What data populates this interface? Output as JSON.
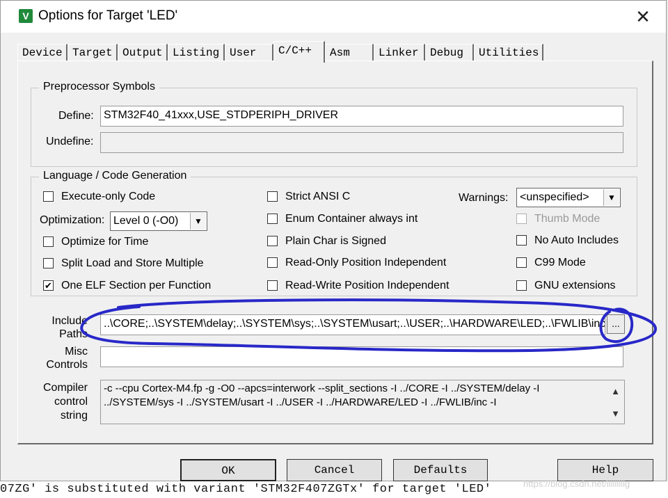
{
  "dialog": {
    "title": "Options for Target 'LED'",
    "close_glyph": "✕",
    "icon_glyph": "V"
  },
  "tabs": [
    "Device",
    "Target",
    "Output",
    "Listing",
    "User",
    "C/C++",
    "Asm",
    "Linker",
    "Debug",
    "Utilities"
  ],
  "active_tab": "C/C++",
  "preprocessor": {
    "group_label": "Preprocessor Symbols",
    "define_label": "Define:",
    "define_value": "STM32F40_41xxx,USE_STDPERIPH_DRIVER",
    "undefine_label": "Undefine:",
    "undefine_value": ""
  },
  "language": {
    "group_label": "Language / Code Generation",
    "execute_only": {
      "label": "Execute-only Code",
      "checked": false
    },
    "optimization": {
      "label": "Optimization:",
      "value": "Level 0 (-O0)"
    },
    "optimize_time": {
      "label": "Optimize for Time",
      "checked": false
    },
    "split_load": {
      "label": "Split Load and Store Multiple",
      "checked": false
    },
    "one_elf": {
      "label": "One ELF Section per Function",
      "checked": true
    },
    "strict_ansi": {
      "label": "Strict ANSI C",
      "checked": false
    },
    "enum_container": {
      "label": "Enum Container always int",
      "checked": false
    },
    "plain_char": {
      "label": "Plain Char is Signed",
      "checked": false
    },
    "ro_position": {
      "label": "Read-Only Position Independent",
      "checked": false
    },
    "rw_position": {
      "label": "Read-Write Position Independent",
      "checked": false
    },
    "warnings": {
      "label": "Warnings:",
      "value": "<unspecified>"
    },
    "thumb_mode": {
      "label": "Thumb Mode",
      "checked": false,
      "disabled": true
    },
    "no_auto_includes": {
      "label": "No Auto Includes",
      "checked": false
    },
    "c99_mode": {
      "label": "C99 Mode",
      "checked": false
    },
    "gnu_extensions": {
      "label": "GNU extensions",
      "checked": false
    }
  },
  "include": {
    "label_line1": "Include",
    "label_line2": "Paths",
    "value": "..\\CORE;..\\SYSTEM\\delay;..\\SYSTEM\\sys;..\\SYSTEM\\usart;..\\USER;..\\HARDWARE\\LED;..\\FWLIB\\inc",
    "browse_label": "..."
  },
  "misc": {
    "label_line1": "Misc",
    "label_line2": "Controls",
    "value": ""
  },
  "compiler": {
    "label_line1": "Compiler",
    "label_line2": "control",
    "label_line3": "string",
    "line1": "-c --cpu Cortex-M4.fp -g -O0 --apcs=interwork --split_sections -I ../CORE -I ../SYSTEM/delay -I",
    "line2": "../SYSTEM/sys -I ../SYSTEM/usart -I ../USER -I ../HARDWARE/LED -I ../FWLIB/inc -I",
    "scroll_up": "▲",
    "scroll_down": "▼"
  },
  "buttons": {
    "ok": "OK",
    "cancel": "Cancel",
    "defaults": "Defaults",
    "help": "Help"
  },
  "background_log": "07ZG' is substituted with variant 'STM32F407ZGTx' for target 'LED'",
  "watermark": "https://blog.csdn.net/lllllllllg",
  "colors": {
    "annotation_ink": "#2828c8",
    "dialog_bg": "#f0f0f0",
    "title_icon": "#1f8a3a"
  }
}
